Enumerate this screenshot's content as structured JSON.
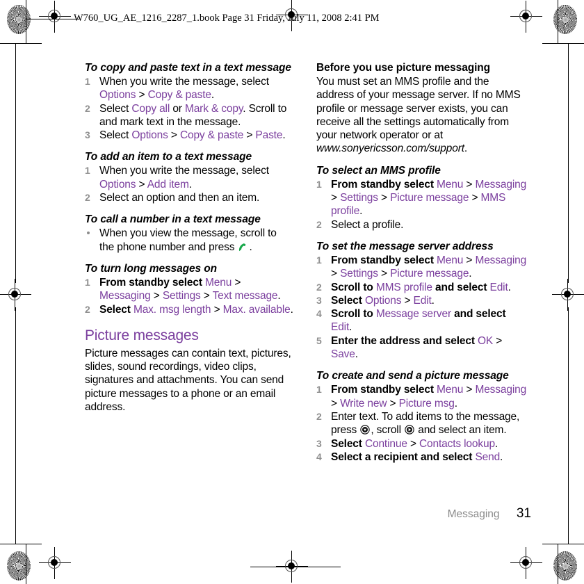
{
  "header": {
    "text": "W760_UG_AE_1216_2287_1.book  Page 31  Friday, July 11, 2008  2:41 PM"
  },
  "footer": {
    "chapter": "Messaging",
    "page_number": "31"
  },
  "colors": {
    "ui_reference": "#7B3F9E",
    "section_heading": "#7B3F9E",
    "step_number": "#909090",
    "footer_chapter": "#8a8a8a",
    "call_icon": "#17a84a",
    "body_text": "#000000"
  },
  "left_column": {
    "blocks": [
      {
        "type": "procedure",
        "title": "To copy and paste text in a text message",
        "list_type": "ordered",
        "steps": [
          {
            "number": "1",
            "parts": [
              {
                "text": "When you write the message, select ",
                "style": "plain"
              },
              {
                "text": "Options",
                "style": "ui"
              },
              {
                "text": " > ",
                "style": "plain"
              },
              {
                "text": "Copy & paste",
                "style": "ui"
              },
              {
                "text": ".",
                "style": "plain"
              }
            ]
          },
          {
            "number": "2",
            "parts": [
              {
                "text": "Select ",
                "style": "plain"
              },
              {
                "text": "Copy all",
                "style": "ui"
              },
              {
                "text": " or ",
                "style": "plain"
              },
              {
                "text": "Mark & copy",
                "style": "ui"
              },
              {
                "text": ". Scroll to and mark text in the message.",
                "style": "plain"
              }
            ]
          },
          {
            "number": "3",
            "parts": [
              {
                "text": "Select ",
                "style": "plain"
              },
              {
                "text": "Options",
                "style": "ui"
              },
              {
                "text": " > ",
                "style": "plain"
              },
              {
                "text": "Copy & paste",
                "style": "ui"
              },
              {
                "text": " > ",
                "style": "plain"
              },
              {
                "text": "Paste",
                "style": "ui"
              },
              {
                "text": ".",
                "style": "plain"
              }
            ]
          }
        ]
      },
      {
        "type": "procedure",
        "title": "To add an item to a text message",
        "list_type": "ordered",
        "steps": [
          {
            "number": "1",
            "parts": [
              {
                "text": "When you write the message, select ",
                "style": "plain"
              },
              {
                "text": "Options",
                "style": "ui"
              },
              {
                "text": " > ",
                "style": "plain"
              },
              {
                "text": "Add item",
                "style": "ui"
              },
              {
                "text": ".",
                "style": "plain"
              }
            ]
          },
          {
            "number": "2",
            "parts": [
              {
                "text": "Select an option and then an item.",
                "style": "plain"
              }
            ]
          }
        ]
      },
      {
        "type": "procedure",
        "title": "To call a number in a text message",
        "list_type": "bulleted",
        "steps": [
          {
            "number": "",
            "parts": [
              {
                "text": "When you view the message, scroll to the phone number and press ",
                "style": "plain"
              },
              {
                "text": "",
                "style": "icon-call"
              },
              {
                "text": ".",
                "style": "plain"
              }
            ]
          }
        ]
      },
      {
        "type": "procedure",
        "title": "To turn long messages on",
        "list_type": "ordered",
        "steps": [
          {
            "number": "1",
            "parts": [
              {
                "text": "From standby select ",
                "style": "bold"
              },
              {
                "text": "Menu",
                "style": "ui"
              },
              {
                "text": " > ",
                "style": "plain"
              },
              {
                "text": "Messaging",
                "style": "ui"
              },
              {
                "text": " > ",
                "style": "plain"
              },
              {
                "text": "Settings",
                "style": "ui"
              },
              {
                "text": " > ",
                "style": "plain"
              },
              {
                "text": "Text message",
                "style": "ui"
              },
              {
                "text": ".",
                "style": "plain"
              }
            ]
          },
          {
            "number": "2",
            "parts": [
              {
                "text": "Select ",
                "style": "bold"
              },
              {
                "text": "Max. msg length",
                "style": "ui"
              },
              {
                "text": " > ",
                "style": "plain"
              },
              {
                "text": "Max. available",
                "style": "ui"
              },
              {
                "text": ".",
                "style": "plain"
              }
            ]
          }
        ]
      },
      {
        "type": "section",
        "heading": "Picture messages",
        "paragraph": "Picture messages can contain text, pictures, slides, sound recordings, video clips, signatures and attachments. You can send picture messages to a phone or an email address."
      }
    ]
  },
  "right_column": {
    "blocks": [
      {
        "type": "note",
        "title": "Before you use picture messaging",
        "title_style": "bold-upright",
        "parts": [
          {
            "text": "You must set an MMS profile and the address of your message server. If no MMS profile or message server exists, you can receive all the settings automatically from your network operator or at ",
            "style": "plain"
          },
          {
            "text": "www.sonyericsson.com/support",
            "style": "italic"
          },
          {
            "text": ".",
            "style": "plain"
          }
        ]
      },
      {
        "type": "procedure",
        "title": "To select an MMS profile",
        "list_type": "ordered",
        "steps": [
          {
            "number": "1",
            "parts": [
              {
                "text": "From standby select ",
                "style": "bold"
              },
              {
                "text": "Menu",
                "style": "ui"
              },
              {
                "text": " > ",
                "style": "plain"
              },
              {
                "text": "Messaging",
                "style": "ui"
              },
              {
                "text": " > ",
                "style": "plain"
              },
              {
                "text": "Settings",
                "style": "ui"
              },
              {
                "text": " > ",
                "style": "plain"
              },
              {
                "text": "Picture message",
                "style": "ui"
              },
              {
                "text": " > ",
                "style": "plain"
              },
              {
                "text": "MMS profile",
                "style": "ui"
              },
              {
                "text": ".",
                "style": "plain"
              }
            ]
          },
          {
            "number": "2",
            "parts": [
              {
                "text": "Select a profile.",
                "style": "plain"
              }
            ]
          }
        ]
      },
      {
        "type": "procedure",
        "title": "To set the message server address",
        "list_type": "ordered",
        "steps": [
          {
            "number": "1",
            "parts": [
              {
                "text": "From standby select ",
                "style": "bold"
              },
              {
                "text": "Menu",
                "style": "ui"
              },
              {
                "text": " > ",
                "style": "plain"
              },
              {
                "text": "Messaging",
                "style": "ui"
              },
              {
                "text": " > ",
                "style": "plain"
              },
              {
                "text": "Settings",
                "style": "ui"
              },
              {
                "text": " > ",
                "style": "plain"
              },
              {
                "text": "Picture message",
                "style": "ui"
              },
              {
                "text": ".",
                "style": "plain"
              }
            ]
          },
          {
            "number": "2",
            "parts": [
              {
                "text": "Scroll to ",
                "style": "bold"
              },
              {
                "text": "MMS profile",
                "style": "ui"
              },
              {
                "text": " and select ",
                "style": "bold"
              },
              {
                "text": "Edit",
                "style": "ui"
              },
              {
                "text": ".",
                "style": "plain"
              }
            ]
          },
          {
            "number": "3",
            "parts": [
              {
                "text": "Select ",
                "style": "bold"
              },
              {
                "text": "Options",
                "style": "ui"
              },
              {
                "text": " > ",
                "style": "plain"
              },
              {
                "text": "Edit",
                "style": "ui"
              },
              {
                "text": ".",
                "style": "plain"
              }
            ]
          },
          {
            "number": "4",
            "parts": [
              {
                "text": "Scroll to ",
                "style": "bold"
              },
              {
                "text": "Message server",
                "style": "ui"
              },
              {
                "text": " and select ",
                "style": "bold"
              },
              {
                "text": "Edit",
                "style": "ui"
              },
              {
                "text": ".",
                "style": "plain"
              }
            ]
          },
          {
            "number": "5",
            "parts": [
              {
                "text": "Enter the address and select ",
                "style": "bold"
              },
              {
                "text": "OK",
                "style": "ui"
              },
              {
                "text": " > ",
                "style": "plain"
              },
              {
                "text": "Save",
                "style": "ui"
              },
              {
                "text": ".",
                "style": "plain"
              }
            ]
          }
        ]
      },
      {
        "type": "procedure",
        "title": "To create and send a picture message",
        "list_type": "ordered",
        "steps": [
          {
            "number": "1",
            "parts": [
              {
                "text": "From standby select ",
                "style": "bold"
              },
              {
                "text": "Menu",
                "style": "ui"
              },
              {
                "text": " > ",
                "style": "plain"
              },
              {
                "text": "Messaging",
                "style": "ui"
              },
              {
                "text": " > ",
                "style": "plain"
              },
              {
                "text": "Write new",
                "style": "ui"
              },
              {
                "text": " > ",
                "style": "plain"
              },
              {
                "text": "Picture msg",
                "style": "ui"
              },
              {
                "text": ".",
                "style": "plain"
              }
            ]
          },
          {
            "number": "2",
            "parts": [
              {
                "text": "Enter text. To add items to the message, press ",
                "style": "plain"
              },
              {
                "text": "",
                "style": "icon-nav-down"
              },
              {
                "text": ", scroll ",
                "style": "plain"
              },
              {
                "text": "",
                "style": "icon-nav-right"
              },
              {
                "text": " and select an item.",
                "style": "plain"
              }
            ]
          },
          {
            "number": "3",
            "parts": [
              {
                "text": "Select ",
                "style": "bold"
              },
              {
                "text": "Continue",
                "style": "ui"
              },
              {
                "text": " > ",
                "style": "plain"
              },
              {
                "text": "Contacts lookup",
                "style": "ui"
              },
              {
                "text": ".",
                "style": "plain"
              }
            ]
          },
          {
            "number": "4",
            "parts": [
              {
                "text": "Select a recipient and select ",
                "style": "bold"
              },
              {
                "text": "Send",
                "style": "ui"
              },
              {
                "text": ".",
                "style": "plain"
              }
            ]
          }
        ]
      }
    ]
  }
}
